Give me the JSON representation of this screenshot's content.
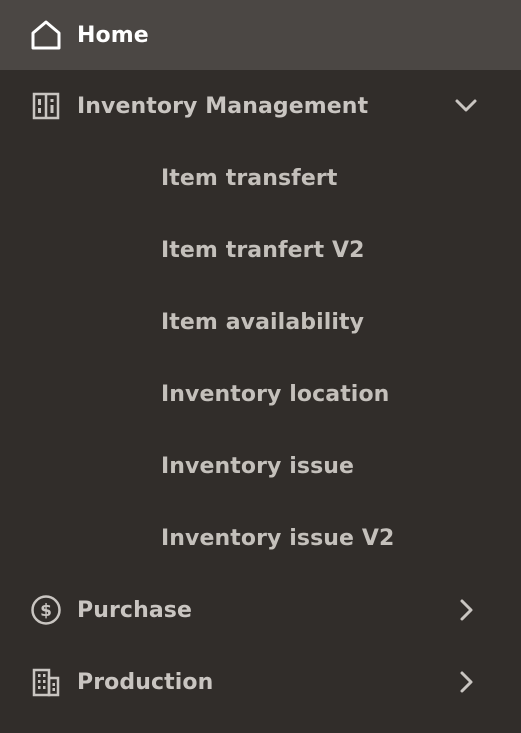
{
  "nav": {
    "home": {
      "label": "Home",
      "icon": "home-icon"
    },
    "inventory": {
      "label": "Inventory Management",
      "icon": "inventory-icon",
      "expanded": true,
      "items": [
        {
          "label": "Item transfert"
        },
        {
          "label": "Item tranfert V2"
        },
        {
          "label": "Item availability"
        },
        {
          "label": "Inventory location"
        },
        {
          "label": "Inventory issue"
        },
        {
          "label": "Inventory issue V2"
        }
      ]
    },
    "purchase": {
      "label": "Purchase",
      "icon": "dollar-icon"
    },
    "production": {
      "label": "Production",
      "icon": "building-icon"
    }
  },
  "colors": {
    "background": "#312d2a",
    "active_row": "#4b4744",
    "text": "#c9c5c1",
    "active_text": "#ffffff"
  }
}
